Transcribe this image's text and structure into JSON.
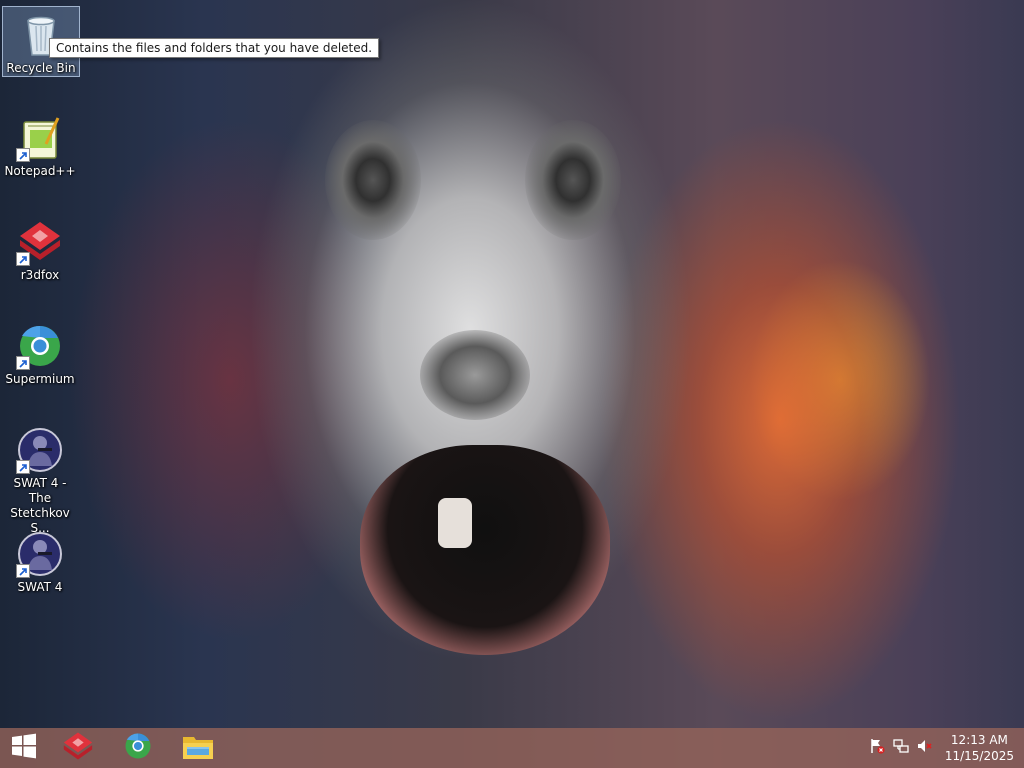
{
  "desktop": {
    "icons": [
      {
        "label": "Recycle Bin",
        "icon": "recycle-bin-icon"
      },
      {
        "label": "Notepad++",
        "icon": "notepad-plus-plus-icon"
      },
      {
        "label": "r3dfox",
        "icon": "r3dfox-icon"
      },
      {
        "label": "Supermium",
        "icon": "supermium-icon"
      },
      {
        "label": "SWAT 4 - The Stetchkov S...",
        "icon": "swat4-icon"
      },
      {
        "label": "SWAT 4",
        "icon": "swat4-icon"
      }
    ]
  },
  "tooltip": {
    "text": "Contains the files and folders that you have deleted."
  },
  "taskbar": {
    "pinned": [
      {
        "icon": "r3dfox-icon"
      },
      {
        "icon": "supermium-icon"
      },
      {
        "icon": "file-explorer-icon"
      }
    ],
    "clock": {
      "time": "12:13 AM",
      "date": "11/15/2025"
    }
  },
  "colors": {
    "taskbar": "#96645a",
    "tooltip_bg": "#ffffff",
    "r3dfox_red": "#e0323c",
    "supermium_blue": "#3a8fd8",
    "supermium_green": "#3aa64a"
  }
}
